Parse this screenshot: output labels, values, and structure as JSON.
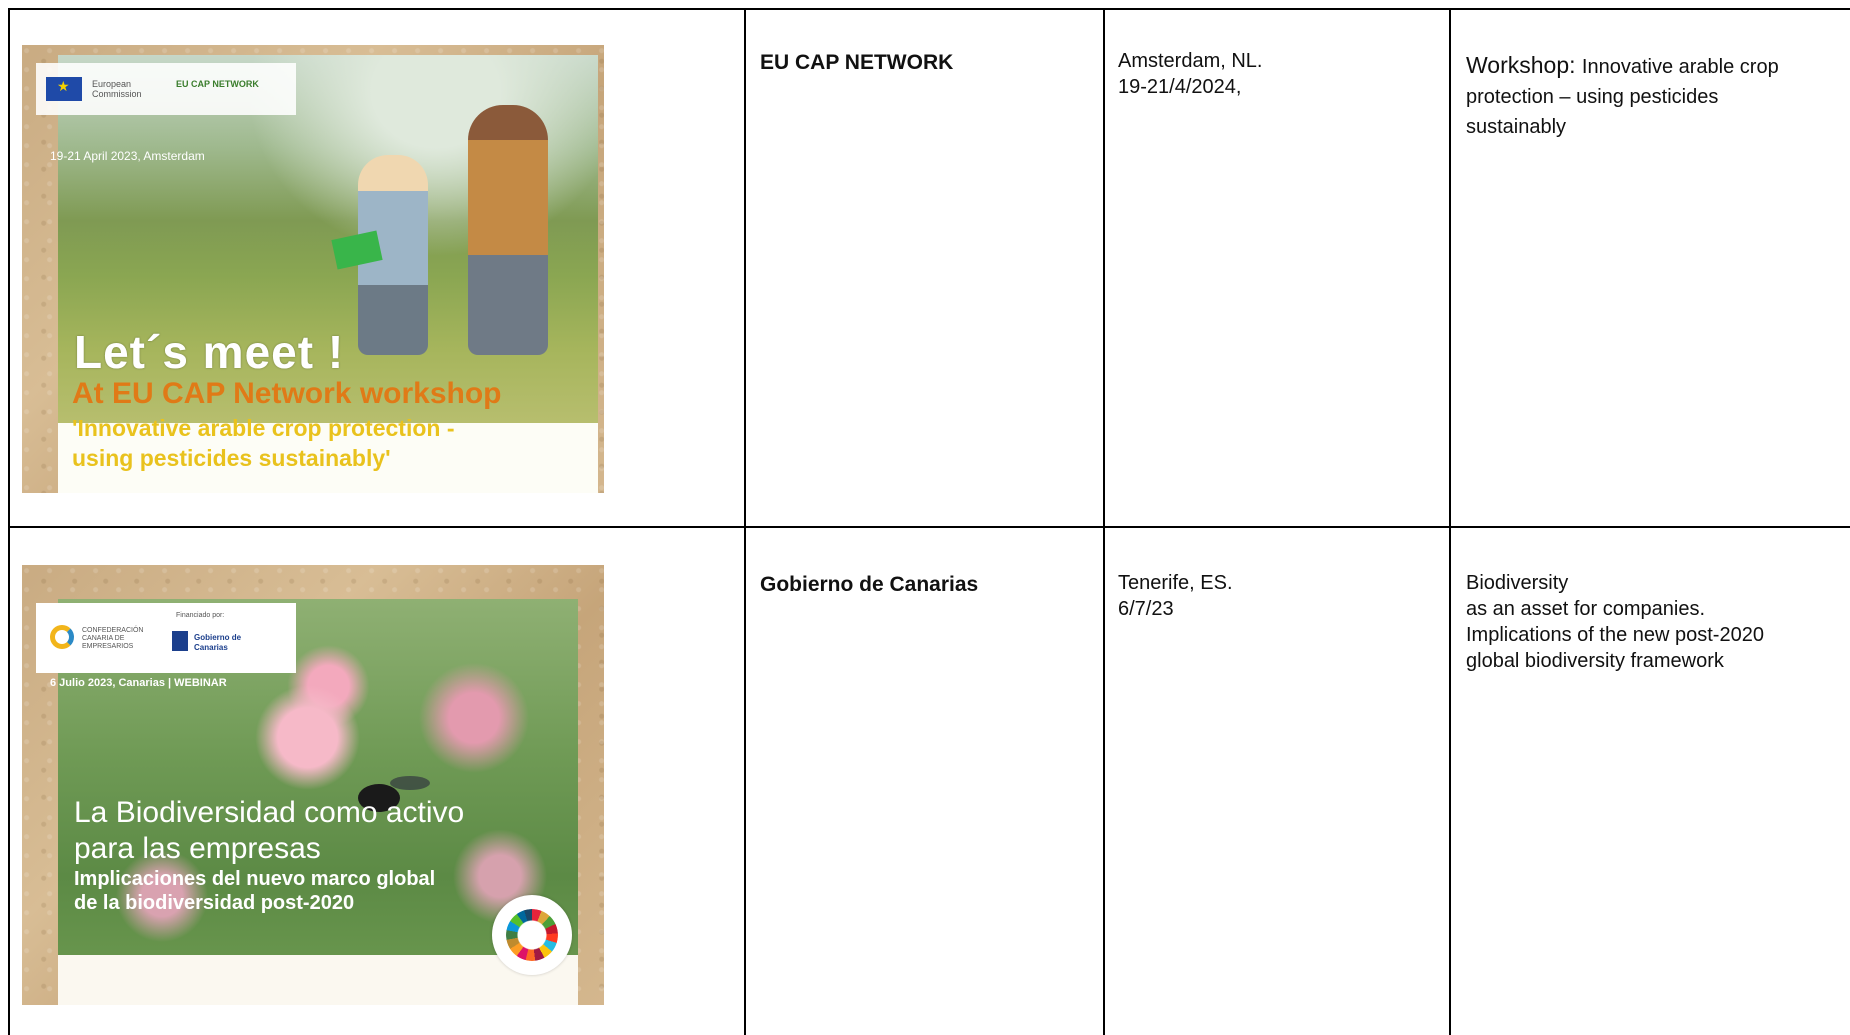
{
  "rows": [
    {
      "poster": {
        "logo_text_1": "European Commission",
        "logo_text_2": "EU CAP NETWORK",
        "date_line": "19-21 April 2023, Amsterdam",
        "headline": "Let´s meet !",
        "subtitle": "At EU CAP Network workshop",
        "subtitle2_line1": "'Innovative arable crop protection -",
        "subtitle2_line2": "using pesticides sustainably'"
      },
      "organizer": "EU CAP NETWORK",
      "location_line1": "Amsterdam, NL.",
      "location_line2": "19-21/4/2024,",
      "topic_prefix": "Workshop: ",
      "topic_line1_rest": "Innovative arable crop",
      "topic_line2": "protection – using pesticides",
      "topic_line3": "sustainably"
    },
    {
      "poster": {
        "logo_text_1": "CONFEDERACIÓN CANARIA DE EMPRESARIOS",
        "funded_by": "Financiado por:",
        "logo_text_2": "Gobierno de Canarias",
        "date_line": "6 Julio 2023, Canarias | WEBINAR",
        "headline_line1": "La Biodiversidad como activo",
        "headline_line2": "para las empresas",
        "sub_line1": "Implicaciones del nuevo marco global",
        "sub_line2": "de la biodiversidad post-2020"
      },
      "organizer": "Gobierno de Canarias",
      "location_line1": "Tenerife, ES.",
      "location_line2": "6/7/23",
      "topic_line1": "Biodiversity",
      "topic_line2": "as an asset for companies.",
      "topic_line3": "Implications of the new post-2020",
      "topic_line4": "global biodiversity framework"
    }
  ]
}
